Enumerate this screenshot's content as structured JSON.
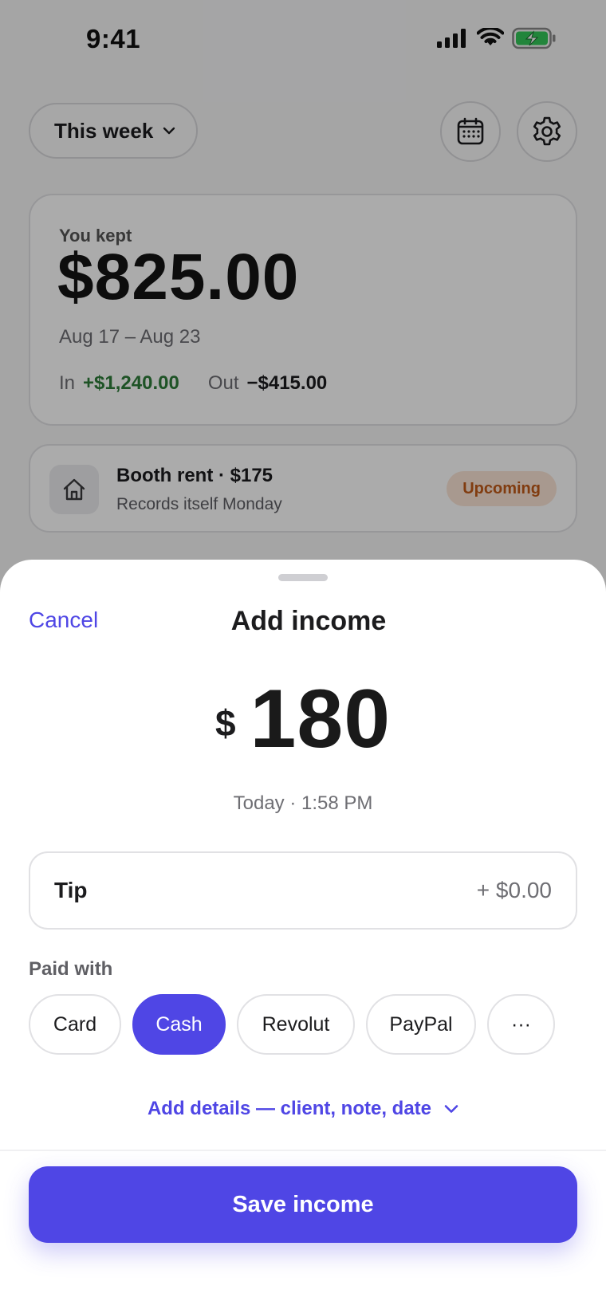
{
  "status_bar": {
    "time": "9:41"
  },
  "header": {
    "range_label": "This week"
  },
  "summary": {
    "kept_label": "You kept",
    "kept_amount": "$825.00",
    "date_range": "Aug 17 – Aug 23",
    "in_label": "In",
    "in_amount": "+$1,240.00",
    "out_label": "Out",
    "out_amount": "−$415.00"
  },
  "recurring": {
    "title": "Booth rent · $175",
    "subtitle": "Records itself Monday",
    "badge": "Upcoming"
  },
  "sheet": {
    "cancel_label": "Cancel",
    "title": "Add income",
    "currency_symbol": "$",
    "amount": "180",
    "timestamp": "Today · 1:58 PM",
    "tip_label": "Tip",
    "tip_value": "+ $0.00",
    "paid_with_label": "Paid with",
    "payment_methods": [
      "Card",
      "Cash",
      "Revolut",
      "PayPal",
      "···"
    ],
    "selected_method": "Cash",
    "details_link": "Add details — client, note, date",
    "save_label": "Save income"
  },
  "colors": {
    "accent": "#4f46e5",
    "positive": "#2e7d3a",
    "badge_text": "#c05a18",
    "badge_bg": "#fbe5d6",
    "battery": "#34c759"
  },
  "icons": [
    "chevron-down-icon",
    "calendar-icon",
    "gear-icon",
    "home-icon",
    "signal-icon",
    "wifi-icon",
    "battery-charging-icon"
  ]
}
